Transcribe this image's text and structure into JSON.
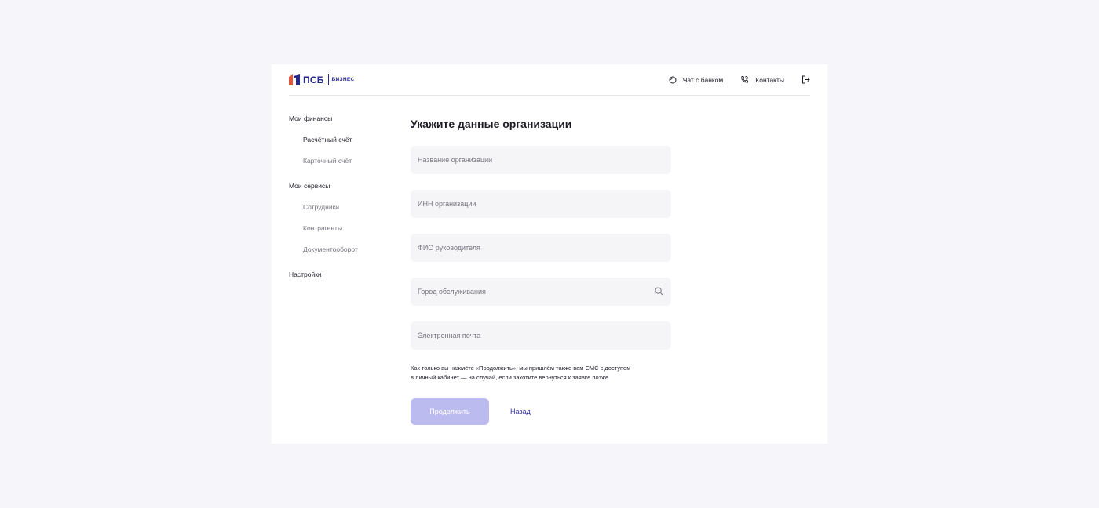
{
  "header": {
    "logo_text": "ПСБ",
    "logo_sub": "БИЗНЕС",
    "chat_label": "Чат с банком",
    "contacts_label": "Контакты",
    "icons": {
      "chat": "chat-bubble-icon",
      "contacts": "phone-icon",
      "logout": "logout-icon"
    }
  },
  "sidebar": {
    "group_finances": "Мои финансы",
    "item_current_account": "Расчётный счёт",
    "item_card_account": "Карточный счёт",
    "group_services": "Мои сервисы",
    "item_employees": "Сотрудники",
    "item_counterparties": "Контрагенты",
    "item_documents": "Документооборот",
    "group_settings": "Настройки"
  },
  "form": {
    "title": "Укажите данные организации",
    "org_name_placeholder": "Название организации",
    "inn_placeholder": "ИНН организации",
    "ceo_placeholder": "ФИО руководителя",
    "city_placeholder": "Город обслуживания",
    "email_placeholder": "Электронная почта",
    "note_line1": "Как только вы нажмёте «Продолжить», мы пришлём также вам СМС с доступом",
    "note_line2": "в личный кабинет — на случай, если захотите вернуться к заявке позже",
    "continue_label": "Продолжить",
    "back_label": "Назад"
  },
  "colors": {
    "background": "#f5f5fa",
    "brand": "#26288f",
    "logo_accent": "#e8513a",
    "primary_disabled": "#bcbbf0",
    "link": "#2d2a9b",
    "field_bg": "#f5f5f7"
  }
}
